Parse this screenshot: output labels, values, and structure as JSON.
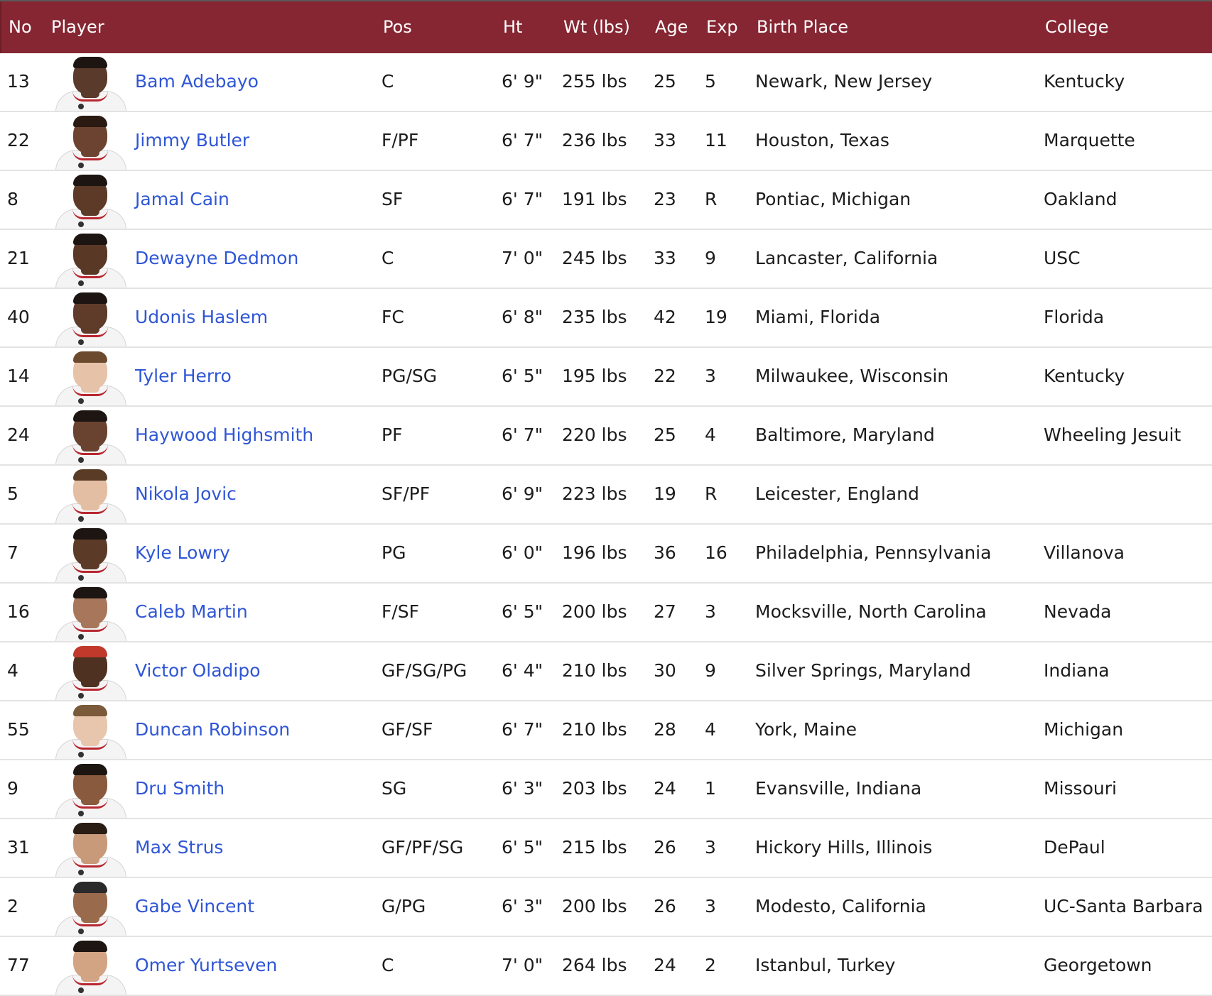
{
  "headers": {
    "no": "No",
    "player": "Player",
    "pos": "Pos",
    "ht": "Ht",
    "wt": "Wt (lbs)",
    "age": "Age",
    "exp": "Exp",
    "birth": "Birth Place",
    "college": "College"
  },
  "players": [
    {
      "no": "13",
      "name": "Bam Adebayo",
      "pos": "C",
      "ht": "6' 9\"",
      "wt": "255 lbs",
      "age": "25",
      "exp": "5",
      "birth": "Newark, New Jersey",
      "college": "Kentucky",
      "skin": "#5a3a2a",
      "hair": "#1d1512"
    },
    {
      "no": "22",
      "name": "Jimmy Butler",
      "pos": "F/PF",
      "ht": "6' 7\"",
      "wt": "236 lbs",
      "age": "33",
      "exp": "11",
      "birth": "Houston, Texas",
      "college": "Marquette",
      "skin": "#6b4330",
      "hair": "#2a1a12"
    },
    {
      "no": "8",
      "name": "Jamal Cain",
      "pos": "SF",
      "ht": "6' 7\"",
      "wt": "191 lbs",
      "age": "23",
      "exp": "R",
      "birth": "Pontiac, Michigan",
      "college": "Oakland",
      "skin": "#5d3a28",
      "hair": "#1d1512"
    },
    {
      "no": "21",
      "name": "Dewayne Dedmon",
      "pos": "C",
      "ht": "7' 0\"",
      "wt": "245 lbs",
      "age": "33",
      "exp": "9",
      "birth": "Lancaster, California",
      "college": "USC",
      "skin": "#5a3826",
      "hair": "#1d1512"
    },
    {
      "no": "40",
      "name": "Udonis Haslem",
      "pos": "FC",
      "ht": "6' 8\"",
      "wt": "235 lbs",
      "age": "42",
      "exp": "19",
      "birth": "Miami, Florida",
      "college": "Florida",
      "skin": "#5f3b29",
      "hair": "#1d1512"
    },
    {
      "no": "14",
      "name": "Tyler Herro",
      "pos": "PG/SG",
      "ht": "6' 5\"",
      "wt": "195 lbs",
      "age": "22",
      "exp": "3",
      "birth": "Milwaukee, Wisconsin",
      "college": "Kentucky",
      "skin": "#e6c2a8",
      "hair": "#6b4a2e"
    },
    {
      "no": "24",
      "name": "Haywood Highsmith",
      "pos": "PF",
      "ht": "6' 7\"",
      "wt": "220 lbs",
      "age": "25",
      "exp": "4",
      "birth": "Baltimore, Maryland",
      "college": "Wheeling Jesuit",
      "skin": "#6a4330",
      "hair": "#1d1512"
    },
    {
      "no": "5",
      "name": "Nikola Jovic",
      "pos": "SF/PF",
      "ht": "6' 9\"",
      "wt": "223 lbs",
      "age": "19",
      "exp": "R",
      "birth": "Leicester, England",
      "college": "",
      "skin": "#e4bea2",
      "hair": "#5a3c26"
    },
    {
      "no": "7",
      "name": "Kyle Lowry",
      "pos": "PG",
      "ht": "6' 0\"",
      "wt": "196 lbs",
      "age": "36",
      "exp": "16",
      "birth": "Philadelphia, Pennsylvania",
      "college": "Villanova",
      "skin": "#5c3a28",
      "hair": "#1d1512"
    },
    {
      "no": "16",
      "name": "Caleb Martin",
      "pos": "F/SF",
      "ht": "6' 5\"",
      "wt": "200 lbs",
      "age": "27",
      "exp": "3",
      "birth": "Mocksville, North Carolina",
      "college": "Nevada",
      "skin": "#a8765a",
      "hair": "#1d1512"
    },
    {
      "no": "4",
      "name": "Victor Oladipo",
      "pos": "GF/SG/PG",
      "ht": "6' 4\"",
      "wt": "210 lbs",
      "age": "30",
      "exp": "9",
      "birth": "Silver Springs, Maryland",
      "college": "Indiana",
      "skin": "#4f3122",
      "hair": "#c0392b"
    },
    {
      "no": "55",
      "name": "Duncan Robinson",
      "pos": "GF/SF",
      "ht": "6' 7\"",
      "wt": "210 lbs",
      "age": "28",
      "exp": "4",
      "birth": "York, Maine",
      "college": "Michigan",
      "skin": "#e8c6ad",
      "hair": "#7a5a3a"
    },
    {
      "no": "9",
      "name": "Dru Smith",
      "pos": "SG",
      "ht": "6' 3\"",
      "wt": "203 lbs",
      "age": "24",
      "exp": "1",
      "birth": "Evansville, Indiana",
      "college": "Missouri",
      "skin": "#8a5a3e",
      "hair": "#1d1512"
    },
    {
      "no": "31",
      "name": "Max Strus",
      "pos": "GF/PF/SG",
      "ht": "6' 5\"",
      "wt": "215 lbs",
      "age": "26",
      "exp": "3",
      "birth": "Hickory Hills, Illinois",
      "college": "DePaul",
      "skin": "#c89a7a",
      "hair": "#2a1d14"
    },
    {
      "no": "2",
      "name": "Gabe Vincent",
      "pos": "G/PG",
      "ht": "6' 3\"",
      "wt": "200 lbs",
      "age": "26",
      "exp": "3",
      "birth": "Modesto, California",
      "college": "UC-Santa Barbara",
      "skin": "#9a6a4c",
      "hair": "#2a2a2a"
    },
    {
      "no": "77",
      "name": "Omer Yurtseven",
      "pos": "C",
      "ht": "7' 0\"",
      "wt": "264 lbs",
      "age": "24",
      "exp": "2",
      "birth": "Istanbul, Turkey",
      "college": "Georgetown",
      "skin": "#d2a484",
      "hair": "#1d1512"
    }
  ]
}
